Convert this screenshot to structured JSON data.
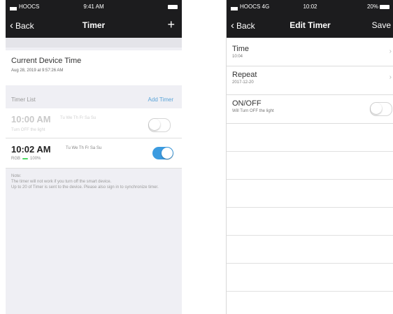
{
  "left_screen": {
    "status": {
      "carrier": "HOOCS",
      "time": "9:41 AM",
      "battery": ""
    },
    "nav": {
      "back_label": "Back",
      "title": "Timer",
      "add_symbol": "+"
    },
    "device_time": {
      "title": "Current Device Time",
      "value": "Aug 28, 2019 at 9:57:26 AM"
    },
    "timer_list": {
      "label": "Timer List",
      "add_label": "Add Timer"
    },
    "timers": [
      {
        "time": "10:00 AM",
        "days": "Tu We Th Fr Sa Su",
        "description": "Turn OFF the light",
        "mode": "",
        "mode_pill": "",
        "brightness": "",
        "enabled": false
      },
      {
        "time": "10:02 AM",
        "days": "Tu We Th Fr Sa Su",
        "description": "",
        "mode": "RGB",
        "mode_pill": "",
        "brightness": "100%",
        "enabled": true
      }
    ],
    "note": "Note:\nThe timer will not work if you turn off the smart device.\nUp to 20 of Timer is sent to the device. Please also sign in to synchronize timer."
  },
  "right_screen": {
    "status": {
      "carrier": "HOOCS 4G",
      "time": "10:02",
      "battery": "20%"
    },
    "nav": {
      "back_label": "Back",
      "title": "Edit Timer",
      "save_label": "Save"
    },
    "rows": {
      "time": {
        "title": "Time",
        "value": "10:04"
      },
      "repeat": {
        "title": "Repeat",
        "value": "2017-12-20"
      },
      "onoff": {
        "title": "ON/OFF",
        "value": "Will Turn OFF the light",
        "enabled": false
      }
    }
  },
  "colors": {
    "header": "#1c1c1e",
    "accent": "#3b9be0",
    "green": "#4cd964"
  },
  "icons": [
    "chevron-left-icon",
    "plus-icon",
    "chevron-right-icon",
    "battery-icon",
    "signal-icon"
  ]
}
